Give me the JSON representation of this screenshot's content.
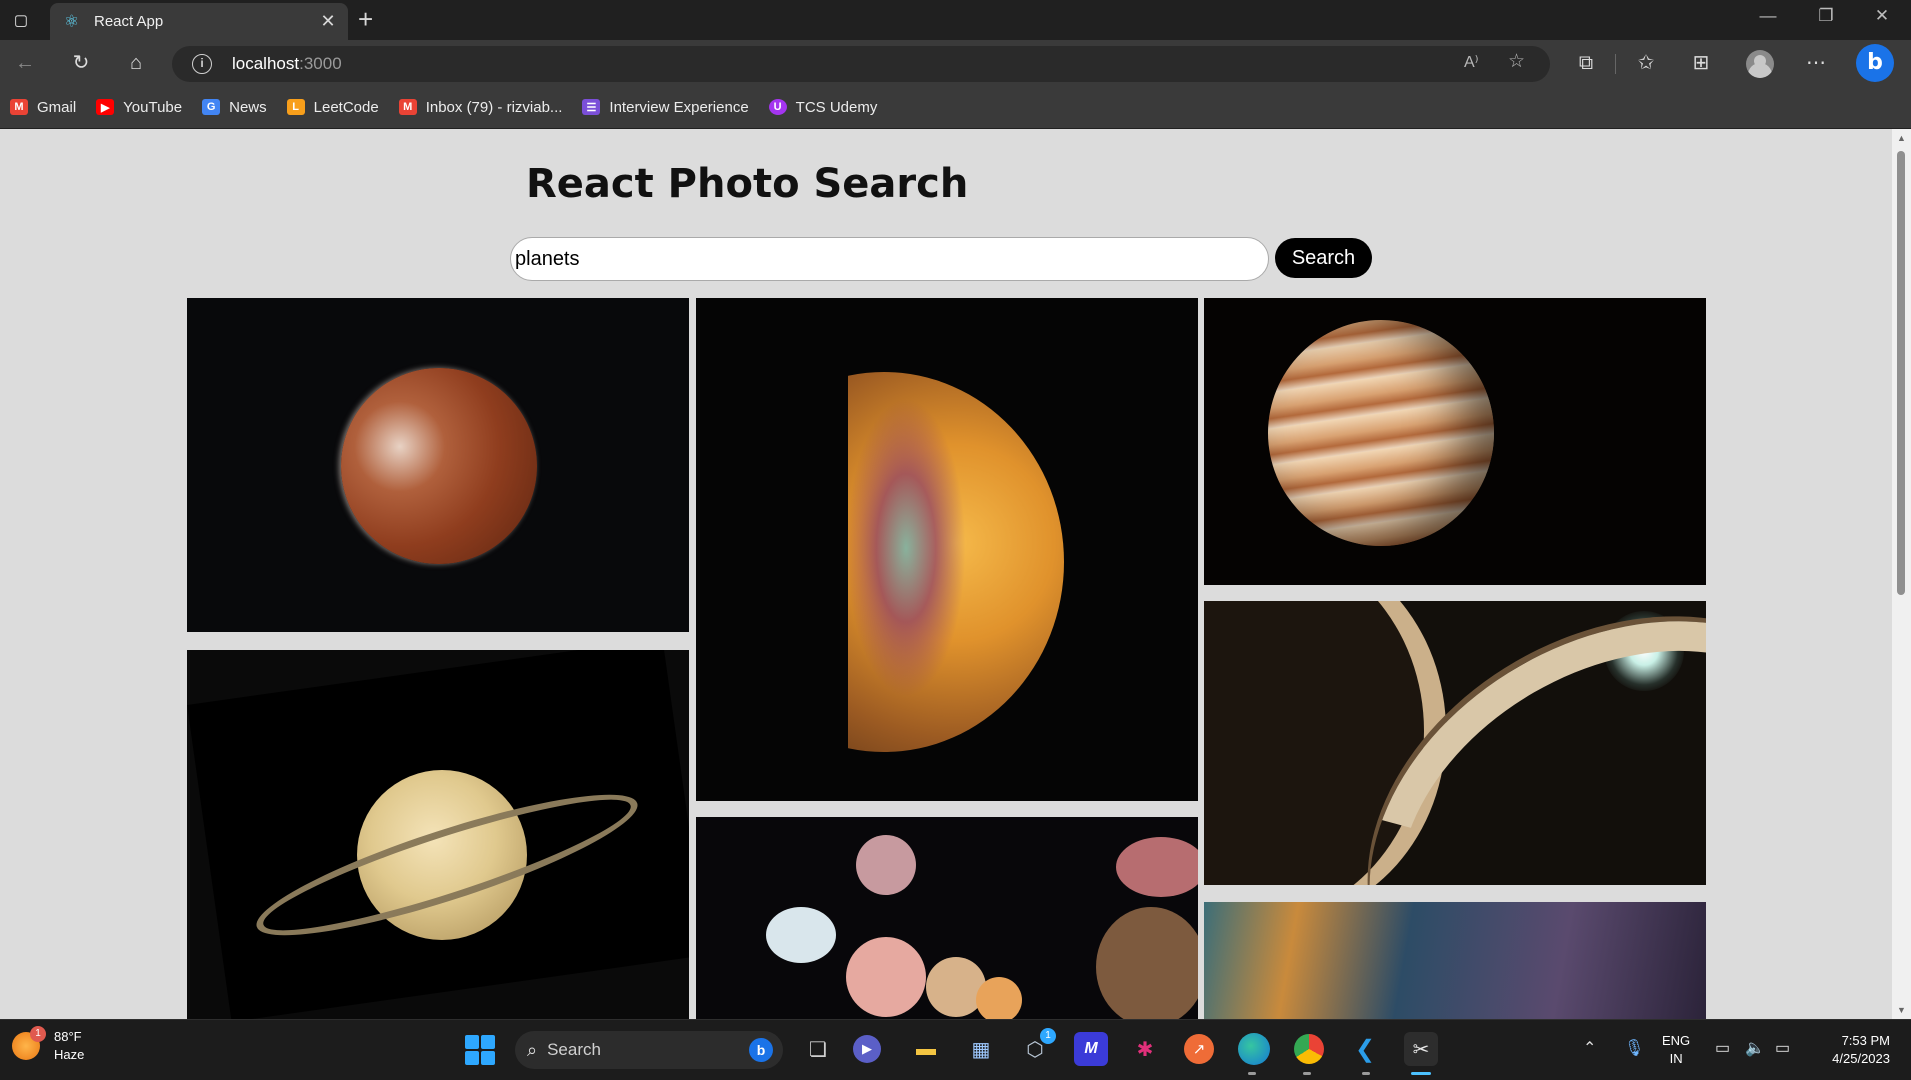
{
  "browser": {
    "tab_title": "React App",
    "url_host": "localhost",
    "url_port": ":3000"
  },
  "bookmarks": [
    {
      "label": "Gmail",
      "icon": "gmail-icon",
      "color": "#ea4335"
    },
    {
      "label": "YouTube",
      "icon": "youtube-icon",
      "color": "#ff0000"
    },
    {
      "label": "News",
      "icon": "news-icon",
      "color": "#4285f4"
    },
    {
      "label": "LeetCode",
      "icon": "leetcode-icon",
      "color": "#f89f1b"
    },
    {
      "label": "Inbox (79) - rizviab...",
      "icon": "gmail-icon",
      "color": "#ea4335"
    },
    {
      "label": "Interview Experience",
      "icon": "list-icon",
      "color": "#7b4fd8"
    },
    {
      "label": "TCS Udemy",
      "icon": "udemy-icon",
      "color": "#a435f0"
    }
  ],
  "page": {
    "title": "React Photo Search",
    "search_value": "planets",
    "search_button": "Search",
    "photos": [
      "moon",
      "marbled-planet",
      "jupiter",
      "saturn",
      "ringed-planet",
      "planets-group",
      "nebula"
    ]
  },
  "taskbar": {
    "weather_temp": "88°F",
    "weather_desc": "Haze",
    "weather_badge": "1",
    "search_label": "Search",
    "lang_line1": "ENG",
    "lang_line2": "IN",
    "time": "7:53 PM",
    "date": "4/25/2023",
    "app_badge": "1"
  },
  "colors": {
    "page_background": "#dcdcdc",
    "search_button_bg": "#000000",
    "windows_accent": "#2ea8ff"
  }
}
